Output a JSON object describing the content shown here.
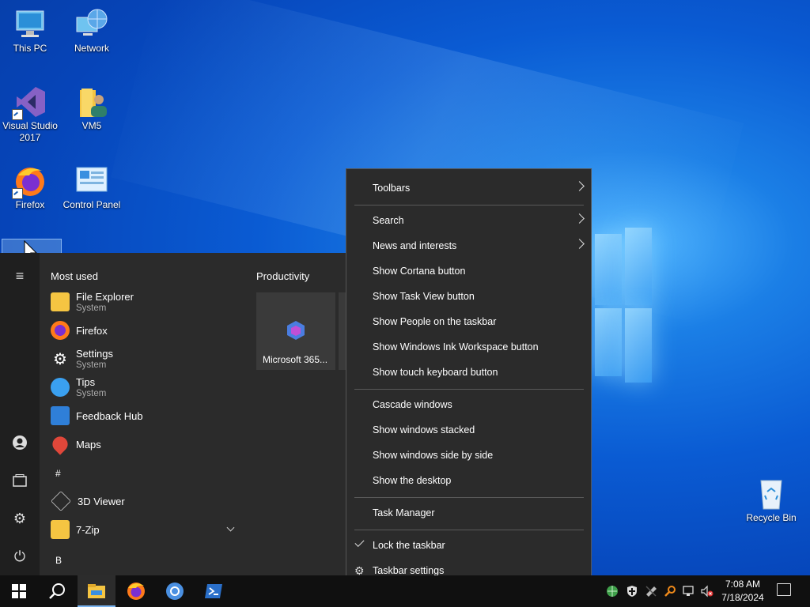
{
  "desktop": {
    "icons": [
      {
        "label": "This PC",
        "icon": "computer-icon"
      },
      {
        "label": "Network",
        "icon": "network-icon"
      },
      {
        "label": "Visual Studio 2017",
        "icon": "visual-studio-icon"
      },
      {
        "label": "VM5",
        "icon": "user-folder-icon"
      },
      {
        "label": "Firefox",
        "icon": "firefox-icon"
      },
      {
        "label": "Control Panel",
        "icon": "control-panel-icon"
      },
      {
        "label": "Recycle Bin",
        "icon": "recycle-bin-icon"
      }
    ]
  },
  "start_menu": {
    "most_used_label": "Most used",
    "productivity_label": "Productivity",
    "apps": [
      {
        "name": "File Explorer",
        "sub": "System"
      },
      {
        "name": "Firefox",
        "sub": ""
      },
      {
        "name": "Settings",
        "sub": "System"
      },
      {
        "name": "Tips",
        "sub": "System"
      },
      {
        "name": "Feedback Hub",
        "sub": ""
      },
      {
        "name": "Maps",
        "sub": ""
      }
    ],
    "hash_header": "#",
    "apps2": [
      {
        "name": "3D Viewer"
      },
      {
        "name": "7-Zip"
      }
    ],
    "b_header": "B",
    "tile_label": "Microsoft 365..."
  },
  "context_menu": {
    "items": [
      {
        "label": "Toolbars",
        "submenu": true
      },
      {
        "label": "Search",
        "submenu": true
      },
      {
        "label": "News and interests",
        "submenu": true
      },
      {
        "label": "Show Cortana button"
      },
      {
        "label": "Show Task View button"
      },
      {
        "label": "Show People on the taskbar"
      },
      {
        "label": "Show Windows Ink Workspace button"
      },
      {
        "label": "Show touch keyboard button"
      },
      {
        "label": "Cascade windows"
      },
      {
        "label": "Show windows stacked"
      },
      {
        "label": "Show windows side by side"
      },
      {
        "label": "Show the desktop"
      },
      {
        "label": "Task Manager"
      },
      {
        "label": "Lock the taskbar",
        "checked": true
      },
      {
        "label": "Taskbar settings",
        "icon": "gear-icon"
      }
    ]
  },
  "taskbar": {
    "time": "7:08 AM",
    "date": "7/18/2024"
  }
}
